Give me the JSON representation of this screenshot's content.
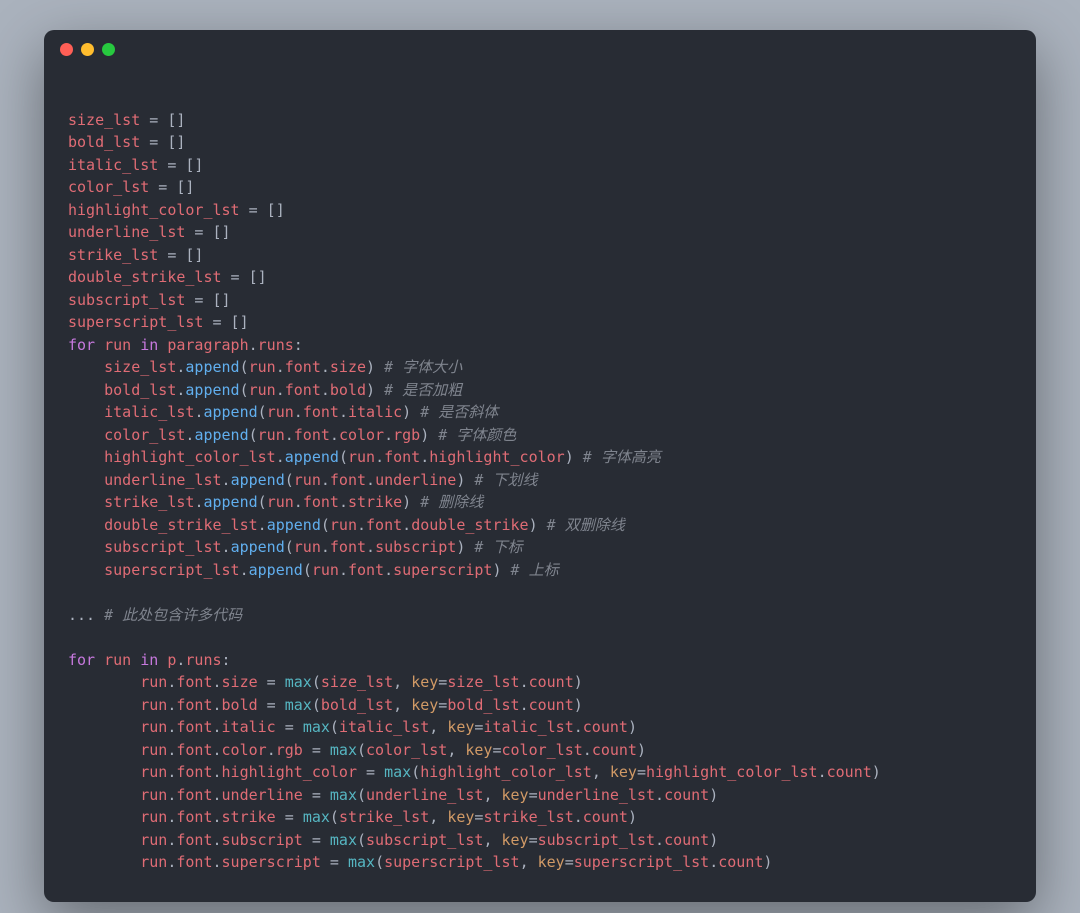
{
  "tokens": [
    [
      [
        "\n",
        " "
      ]
    ],
    [
      [
        "size_lst",
        "c-red"
      ],
      [
        " = []",
        "c-gray"
      ]
    ],
    [
      [
        "bold_lst",
        "c-red"
      ],
      [
        " = []",
        "c-gray"
      ]
    ],
    [
      [
        "italic_lst",
        "c-red"
      ],
      [
        " = []",
        "c-gray"
      ]
    ],
    [
      [
        "color_lst",
        "c-red"
      ],
      [
        " = []",
        "c-gray"
      ]
    ],
    [
      [
        "highlight_color_lst",
        "c-red"
      ],
      [
        " = []",
        "c-gray"
      ]
    ],
    [
      [
        "underline_lst",
        "c-red"
      ],
      [
        " = []",
        "c-gray"
      ]
    ],
    [
      [
        "strike_lst",
        "c-red"
      ],
      [
        " = []",
        "c-gray"
      ]
    ],
    [
      [
        "double_strike_lst",
        "c-red"
      ],
      [
        " = []",
        "c-gray"
      ]
    ],
    [
      [
        "subscript_lst",
        "c-red"
      ],
      [
        " = []",
        "c-gray"
      ]
    ],
    [
      [
        "superscript_lst",
        "c-red"
      ],
      [
        " = []",
        "c-gray"
      ]
    ],
    [
      [
        "for",
        "c-purple"
      ],
      [
        " ",
        "c-gray"
      ],
      [
        "run",
        "c-red"
      ],
      [
        " ",
        "c-gray"
      ],
      [
        "in",
        "c-purple"
      ],
      [
        " ",
        "c-gray"
      ],
      [
        "paragraph",
        "c-red"
      ],
      [
        ".",
        "c-gray"
      ],
      [
        "runs",
        "c-red"
      ],
      [
        ":",
        "c-gray"
      ]
    ],
    [
      [
        "    ",
        "c-gray"
      ],
      [
        "size_lst",
        "c-red"
      ],
      [
        ".",
        "c-gray"
      ],
      [
        "append",
        "c-blue"
      ],
      [
        "(",
        "c-gray"
      ],
      [
        "run",
        "c-red"
      ],
      [
        ".",
        "c-gray"
      ],
      [
        "font",
        "c-red"
      ],
      [
        ".",
        "c-gray"
      ],
      [
        "size",
        "c-red"
      ],
      [
        ") ",
        "c-gray"
      ],
      [
        "# 字体大小",
        "c-comment"
      ]
    ],
    [
      [
        "    ",
        "c-gray"
      ],
      [
        "bold_lst",
        "c-red"
      ],
      [
        ".",
        "c-gray"
      ],
      [
        "append",
        "c-blue"
      ],
      [
        "(",
        "c-gray"
      ],
      [
        "run",
        "c-red"
      ],
      [
        ".",
        "c-gray"
      ],
      [
        "font",
        "c-red"
      ],
      [
        ".",
        "c-gray"
      ],
      [
        "bold",
        "c-red"
      ],
      [
        ") ",
        "c-gray"
      ],
      [
        "# 是否加粗",
        "c-comment"
      ]
    ],
    [
      [
        "    ",
        "c-gray"
      ],
      [
        "italic_lst",
        "c-red"
      ],
      [
        ".",
        "c-gray"
      ],
      [
        "append",
        "c-blue"
      ],
      [
        "(",
        "c-gray"
      ],
      [
        "run",
        "c-red"
      ],
      [
        ".",
        "c-gray"
      ],
      [
        "font",
        "c-red"
      ],
      [
        ".",
        "c-gray"
      ],
      [
        "italic",
        "c-red"
      ],
      [
        ") ",
        "c-gray"
      ],
      [
        "# 是否斜体",
        "c-comment"
      ]
    ],
    [
      [
        "    ",
        "c-gray"
      ],
      [
        "color_lst",
        "c-red"
      ],
      [
        ".",
        "c-gray"
      ],
      [
        "append",
        "c-blue"
      ],
      [
        "(",
        "c-gray"
      ],
      [
        "run",
        "c-red"
      ],
      [
        ".",
        "c-gray"
      ],
      [
        "font",
        "c-red"
      ],
      [
        ".",
        "c-gray"
      ],
      [
        "color",
        "c-red"
      ],
      [
        ".",
        "c-gray"
      ],
      [
        "rgb",
        "c-red"
      ],
      [
        ") ",
        "c-gray"
      ],
      [
        "# 字体颜色",
        "c-comment"
      ]
    ],
    [
      [
        "    ",
        "c-gray"
      ],
      [
        "highlight_color_lst",
        "c-red"
      ],
      [
        ".",
        "c-gray"
      ],
      [
        "append",
        "c-blue"
      ],
      [
        "(",
        "c-gray"
      ],
      [
        "run",
        "c-red"
      ],
      [
        ".",
        "c-gray"
      ],
      [
        "font",
        "c-red"
      ],
      [
        ".",
        "c-gray"
      ],
      [
        "highlight_color",
        "c-red"
      ],
      [
        ") ",
        "c-gray"
      ],
      [
        "# 字体高亮",
        "c-comment"
      ]
    ],
    [
      [
        "    ",
        "c-gray"
      ],
      [
        "underline_lst",
        "c-red"
      ],
      [
        ".",
        "c-gray"
      ],
      [
        "append",
        "c-blue"
      ],
      [
        "(",
        "c-gray"
      ],
      [
        "run",
        "c-red"
      ],
      [
        ".",
        "c-gray"
      ],
      [
        "font",
        "c-red"
      ],
      [
        ".",
        "c-gray"
      ],
      [
        "underline",
        "c-red"
      ],
      [
        ") ",
        "c-gray"
      ],
      [
        "# 下划线",
        "c-comment"
      ]
    ],
    [
      [
        "    ",
        "c-gray"
      ],
      [
        "strike_lst",
        "c-red"
      ],
      [
        ".",
        "c-gray"
      ],
      [
        "append",
        "c-blue"
      ],
      [
        "(",
        "c-gray"
      ],
      [
        "run",
        "c-red"
      ],
      [
        ".",
        "c-gray"
      ],
      [
        "font",
        "c-red"
      ],
      [
        ".",
        "c-gray"
      ],
      [
        "strike",
        "c-red"
      ],
      [
        ") ",
        "c-gray"
      ],
      [
        "# 删除线",
        "c-comment"
      ]
    ],
    [
      [
        "    ",
        "c-gray"
      ],
      [
        "double_strike_lst",
        "c-red"
      ],
      [
        ".",
        "c-gray"
      ],
      [
        "append",
        "c-blue"
      ],
      [
        "(",
        "c-gray"
      ],
      [
        "run",
        "c-red"
      ],
      [
        ".",
        "c-gray"
      ],
      [
        "font",
        "c-red"
      ],
      [
        ".",
        "c-gray"
      ],
      [
        "double_strike",
        "c-red"
      ],
      [
        ") ",
        "c-gray"
      ],
      [
        "# 双删除线",
        "c-comment"
      ]
    ],
    [
      [
        "    ",
        "c-gray"
      ],
      [
        "subscript_lst",
        "c-red"
      ],
      [
        ".",
        "c-gray"
      ],
      [
        "append",
        "c-blue"
      ],
      [
        "(",
        "c-gray"
      ],
      [
        "run",
        "c-red"
      ],
      [
        ".",
        "c-gray"
      ],
      [
        "font",
        "c-red"
      ],
      [
        ".",
        "c-gray"
      ],
      [
        "subscript",
        "c-red"
      ],
      [
        ") ",
        "c-gray"
      ],
      [
        "# 下标",
        "c-comment"
      ]
    ],
    [
      [
        "    ",
        "c-gray"
      ],
      [
        "superscript_lst",
        "c-red"
      ],
      [
        ".",
        "c-gray"
      ],
      [
        "append",
        "c-blue"
      ],
      [
        "(",
        "c-gray"
      ],
      [
        "run",
        "c-red"
      ],
      [
        ".",
        "c-gray"
      ],
      [
        "font",
        "c-red"
      ],
      [
        ".",
        "c-gray"
      ],
      [
        "superscript",
        "c-red"
      ],
      [
        ") ",
        "c-gray"
      ],
      [
        "# 上标",
        "c-comment"
      ]
    ],
    [
      [
        " ",
        " "
      ]
    ],
    [
      [
        "... ",
        "c-gray"
      ],
      [
        "# 此处包含许多代码",
        "c-comment"
      ]
    ],
    [
      [
        " ",
        " "
      ]
    ],
    [
      [
        "for",
        "c-purple"
      ],
      [
        " ",
        "c-gray"
      ],
      [
        "run",
        "c-red"
      ],
      [
        " ",
        "c-gray"
      ],
      [
        "in",
        "c-purple"
      ],
      [
        " ",
        "c-gray"
      ],
      [
        "p",
        "c-red"
      ],
      [
        ".",
        "c-gray"
      ],
      [
        "runs",
        "c-red"
      ],
      [
        ":",
        "c-gray"
      ]
    ],
    [
      [
        "        ",
        "c-gray"
      ],
      [
        "run",
        "c-red"
      ],
      [
        ".",
        "c-gray"
      ],
      [
        "font",
        "c-red"
      ],
      [
        ".",
        "c-gray"
      ],
      [
        "size",
        "c-red"
      ],
      [
        " = ",
        "c-gray"
      ],
      [
        "max",
        "c-cyan"
      ],
      [
        "(",
        "c-gray"
      ],
      [
        "size_lst",
        "c-red"
      ],
      [
        ", ",
        "c-gray"
      ],
      [
        "key",
        "c-orange"
      ],
      [
        "=",
        "c-gray"
      ],
      [
        "size_lst",
        "c-red"
      ],
      [
        ".",
        "c-gray"
      ],
      [
        "count",
        "c-red"
      ],
      [
        ")",
        "c-gray"
      ]
    ],
    [
      [
        "        ",
        "c-gray"
      ],
      [
        "run",
        "c-red"
      ],
      [
        ".",
        "c-gray"
      ],
      [
        "font",
        "c-red"
      ],
      [
        ".",
        "c-gray"
      ],
      [
        "bold",
        "c-red"
      ],
      [
        " = ",
        "c-gray"
      ],
      [
        "max",
        "c-cyan"
      ],
      [
        "(",
        "c-gray"
      ],
      [
        "bold_lst",
        "c-red"
      ],
      [
        ", ",
        "c-gray"
      ],
      [
        "key",
        "c-orange"
      ],
      [
        "=",
        "c-gray"
      ],
      [
        "bold_lst",
        "c-red"
      ],
      [
        ".",
        "c-gray"
      ],
      [
        "count",
        "c-red"
      ],
      [
        ")",
        "c-gray"
      ]
    ],
    [
      [
        "        ",
        "c-gray"
      ],
      [
        "run",
        "c-red"
      ],
      [
        ".",
        "c-gray"
      ],
      [
        "font",
        "c-red"
      ],
      [
        ".",
        "c-gray"
      ],
      [
        "italic",
        "c-red"
      ],
      [
        " = ",
        "c-gray"
      ],
      [
        "max",
        "c-cyan"
      ],
      [
        "(",
        "c-gray"
      ],
      [
        "italic_lst",
        "c-red"
      ],
      [
        ", ",
        "c-gray"
      ],
      [
        "key",
        "c-orange"
      ],
      [
        "=",
        "c-gray"
      ],
      [
        "italic_lst",
        "c-red"
      ],
      [
        ".",
        "c-gray"
      ],
      [
        "count",
        "c-red"
      ],
      [
        ")",
        "c-gray"
      ]
    ],
    [
      [
        "        ",
        "c-gray"
      ],
      [
        "run",
        "c-red"
      ],
      [
        ".",
        "c-gray"
      ],
      [
        "font",
        "c-red"
      ],
      [
        ".",
        "c-gray"
      ],
      [
        "color",
        "c-red"
      ],
      [
        ".",
        "c-gray"
      ],
      [
        "rgb",
        "c-red"
      ],
      [
        " = ",
        "c-gray"
      ],
      [
        "max",
        "c-cyan"
      ],
      [
        "(",
        "c-gray"
      ],
      [
        "color_lst",
        "c-red"
      ],
      [
        ", ",
        "c-gray"
      ],
      [
        "key",
        "c-orange"
      ],
      [
        "=",
        "c-gray"
      ],
      [
        "color_lst",
        "c-red"
      ],
      [
        ".",
        "c-gray"
      ],
      [
        "count",
        "c-red"
      ],
      [
        ")",
        "c-gray"
      ]
    ],
    [
      [
        "        ",
        "c-gray"
      ],
      [
        "run",
        "c-red"
      ],
      [
        ".",
        "c-gray"
      ],
      [
        "font",
        "c-red"
      ],
      [
        ".",
        "c-gray"
      ],
      [
        "highlight_color",
        "c-red"
      ],
      [
        " = ",
        "c-gray"
      ],
      [
        "max",
        "c-cyan"
      ],
      [
        "(",
        "c-gray"
      ],
      [
        "highlight_color_lst",
        "c-red"
      ],
      [
        ", ",
        "c-gray"
      ],
      [
        "key",
        "c-orange"
      ],
      [
        "=",
        "c-gray"
      ],
      [
        "highlight_color_lst",
        "c-red"
      ],
      [
        ".",
        "c-gray"
      ],
      [
        "count",
        "c-red"
      ],
      [
        ")",
        "c-gray"
      ]
    ],
    [
      [
        "        ",
        "c-gray"
      ],
      [
        "run",
        "c-red"
      ],
      [
        ".",
        "c-gray"
      ],
      [
        "font",
        "c-red"
      ],
      [
        ".",
        "c-gray"
      ],
      [
        "underline",
        "c-red"
      ],
      [
        " = ",
        "c-gray"
      ],
      [
        "max",
        "c-cyan"
      ],
      [
        "(",
        "c-gray"
      ],
      [
        "underline_lst",
        "c-red"
      ],
      [
        ", ",
        "c-gray"
      ],
      [
        "key",
        "c-orange"
      ],
      [
        "=",
        "c-gray"
      ],
      [
        "underline_lst",
        "c-red"
      ],
      [
        ".",
        "c-gray"
      ],
      [
        "count",
        "c-red"
      ],
      [
        ")",
        "c-gray"
      ]
    ],
    [
      [
        "        ",
        "c-gray"
      ],
      [
        "run",
        "c-red"
      ],
      [
        ".",
        "c-gray"
      ],
      [
        "font",
        "c-red"
      ],
      [
        ".",
        "c-gray"
      ],
      [
        "strike",
        "c-red"
      ],
      [
        " = ",
        "c-gray"
      ],
      [
        "max",
        "c-cyan"
      ],
      [
        "(",
        "c-gray"
      ],
      [
        "strike_lst",
        "c-red"
      ],
      [
        ", ",
        "c-gray"
      ],
      [
        "key",
        "c-orange"
      ],
      [
        "=",
        "c-gray"
      ],
      [
        "strike_lst",
        "c-red"
      ],
      [
        ".",
        "c-gray"
      ],
      [
        "count",
        "c-red"
      ],
      [
        ")",
        "c-gray"
      ]
    ],
    [
      [
        "        ",
        "c-gray"
      ],
      [
        "run",
        "c-red"
      ],
      [
        ".",
        "c-gray"
      ],
      [
        "font",
        "c-red"
      ],
      [
        ".",
        "c-gray"
      ],
      [
        "subscript",
        "c-red"
      ],
      [
        " = ",
        "c-gray"
      ],
      [
        "max",
        "c-cyan"
      ],
      [
        "(",
        "c-gray"
      ],
      [
        "subscript_lst",
        "c-red"
      ],
      [
        ", ",
        "c-gray"
      ],
      [
        "key",
        "c-orange"
      ],
      [
        "=",
        "c-gray"
      ],
      [
        "subscript_lst",
        "c-red"
      ],
      [
        ".",
        "c-gray"
      ],
      [
        "count",
        "c-red"
      ],
      [
        ")",
        "c-gray"
      ]
    ],
    [
      [
        "        ",
        "c-gray"
      ],
      [
        "run",
        "c-red"
      ],
      [
        ".",
        "c-gray"
      ],
      [
        "font",
        "c-red"
      ],
      [
        ".",
        "c-gray"
      ],
      [
        "superscript",
        "c-red"
      ],
      [
        " = ",
        "c-gray"
      ],
      [
        "max",
        "c-cyan"
      ],
      [
        "(",
        "c-gray"
      ],
      [
        "superscript_lst",
        "c-red"
      ],
      [
        ", ",
        "c-gray"
      ],
      [
        "key",
        "c-orange"
      ],
      [
        "=",
        "c-gray"
      ],
      [
        "superscript_lst",
        "c-red"
      ],
      [
        ".",
        "c-gray"
      ],
      [
        "count",
        "c-red"
      ],
      [
        ")",
        "c-gray"
      ]
    ]
  ]
}
